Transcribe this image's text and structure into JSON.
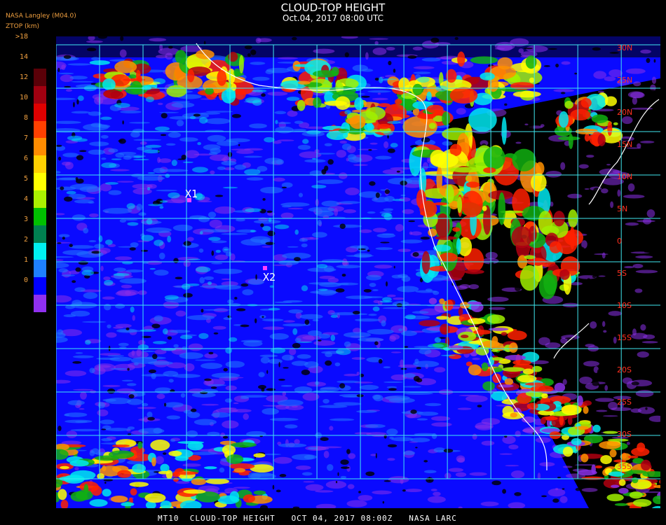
{
  "header": {
    "title": "CLOUD-TOP HEIGHT",
    "subtitle": "Oct.04, 2017 08:00 UTC",
    "org": "NASA Langley (M04.0)",
    "variable": "ZTOP (km)"
  },
  "legend": {
    "ticks": [
      ">18",
      "14",
      "12",
      "10",
      "8",
      "7",
      "6",
      "5",
      "4",
      "3",
      "2",
      "1",
      "0"
    ],
    "colors": [
      "#5a0008",
      "#a00010",
      "#e00000",
      "#ff4000",
      "#ff8c00",
      "#ffd000",
      "#ffff00",
      "#aaf000",
      "#00c000",
      "#008050",
      "#00f0f0",
      "#1e80ff",
      "#0000ff",
      "#9030f0"
    ]
  },
  "map": {
    "grid_color": "#40e8f0",
    "markers": [
      {
        "label": "X1",
        "color": "#ff40ff"
      },
      {
        "label": "X2",
        "color": "#ff40ff"
      }
    ],
    "lat_labels": [
      "30N",
      "25N",
      "20N",
      "15N",
      "10N",
      "5N",
      "0",
      "5S",
      "10S",
      "15S",
      "20S",
      "25S",
      "30S",
      "35S"
    ]
  },
  "footer": "MT10  CLOUD-TOP HEIGHT   OCT 04, 2017 08:00Z   NASA LARC"
}
